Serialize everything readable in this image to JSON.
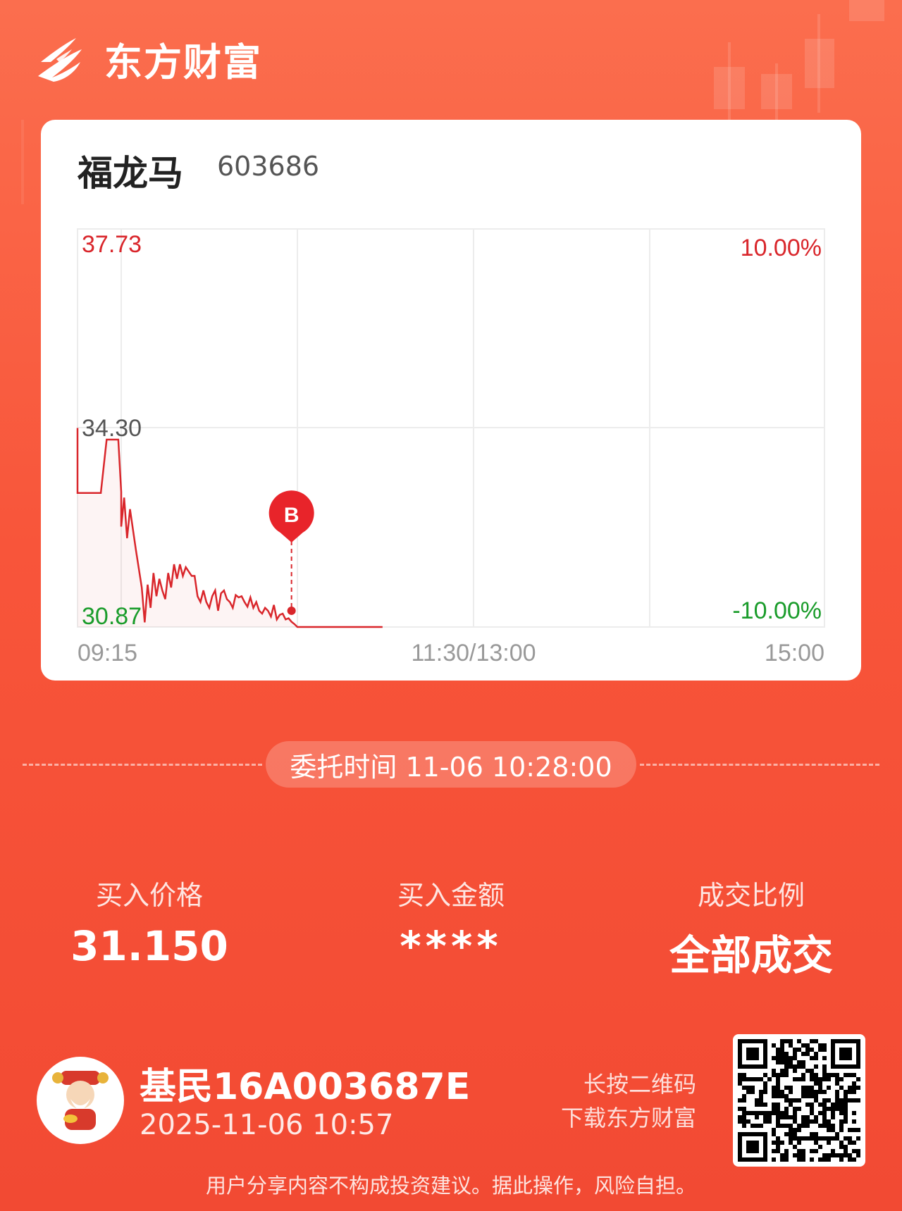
{
  "brand": {
    "name": "东方财富"
  },
  "stock": {
    "name": "福龙马",
    "code": "603686"
  },
  "chart": {
    "price_high_label": "37.73",
    "price_mid_label": "34.30",
    "price_low_label": "30.87",
    "pct_high_label": "10.00%",
    "pct_low_label": "-10.00%",
    "time_start": "09:15",
    "time_mid": "11:30/13:00",
    "time_end": "15:00",
    "marker_label": "B",
    "up_color": "#d9262b",
    "down_color": "#1a9c2b"
  },
  "chart_data": {
    "type": "line",
    "ylim": [
      30.87,
      37.73
    ],
    "points": [
      [
        "09:15",
        34.3
      ],
      [
        "09:15",
        33.18
      ],
      [
        "09:23",
        33.18
      ],
      [
        "09:25",
        34.1
      ],
      [
        "09:29",
        34.1
      ],
      [
        "09:30",
        33.2
      ],
      [
        "09:30",
        32.6
      ],
      [
        "09:31",
        33.1
      ],
      [
        "09:32",
        32.4
      ],
      [
        "09:33",
        32.9
      ],
      [
        "09:35",
        32.2
      ],
      [
        "09:37",
        31.55
      ],
      [
        "09:38",
        30.95
      ],
      [
        "09:39",
        31.6
      ],
      [
        "09:40",
        31.2
      ],
      [
        "09:41",
        31.8
      ],
      [
        "09:42",
        31.4
      ],
      [
        "09:43",
        31.7
      ],
      [
        "09:44",
        31.5
      ],
      [
        "09:45",
        31.35
      ],
      [
        "09:46",
        31.8
      ],
      [
        "09:47",
        31.55
      ],
      [
        "09:48",
        31.95
      ],
      [
        "09:49",
        31.7
      ],
      [
        "09:50",
        31.95
      ],
      [
        "09:51",
        31.75
      ],
      [
        "09:52",
        31.9
      ],
      [
        "09:54",
        31.75
      ],
      [
        "09:55",
        31.75
      ],
      [
        "09:56",
        31.4
      ],
      [
        "09:57",
        31.3
      ],
      [
        "09:58",
        31.5
      ],
      [
        "09:59",
        31.3
      ],
      [
        "10:00",
        31.2
      ],
      [
        "10:01",
        31.4
      ],
      [
        "10:02",
        31.5
      ],
      [
        "10:03",
        31.15
      ],
      [
        "10:04",
        31.45
      ],
      [
        "10:05",
        31.5
      ],
      [
        "10:06",
        31.35
      ],
      [
        "10:07",
        31.3
      ],
      [
        "10:08",
        31.2
      ],
      [
        "10:09",
        31.42
      ],
      [
        "10:10",
        31.38
      ],
      [
        "10:11",
        31.4
      ],
      [
        "10:12",
        31.3
      ],
      [
        "10:13",
        31.22
      ],
      [
        "10:14",
        31.38
      ],
      [
        "10:15",
        31.2
      ],
      [
        "10:16",
        31.3
      ],
      [
        "10:17",
        31.15
      ],
      [
        "10:18",
        31.1
      ],
      [
        "10:19",
        31.2
      ],
      [
        "10:20",
        31.15
      ],
      [
        "10:21",
        31.05
      ],
      [
        "10:22",
        31.25
      ],
      [
        "10:23",
        31.0
      ],
      [
        "10:24",
        31.08
      ],
      [
        "10:25",
        31.1
      ],
      [
        "10:26",
        31.0
      ],
      [
        "10:27",
        31.02
      ],
      [
        "10:28",
        30.96
      ],
      [
        "10:29",
        30.92
      ],
      [
        "10:30",
        30.87
      ],
      [
        "10:59",
        30.87
      ]
    ],
    "buy_marker": {
      "x": "10:28",
      "y": 31.15,
      "label": "B"
    },
    "grid": true
  },
  "commission": {
    "label": "委托时间 11-06 10:28:00"
  },
  "stats": [
    {
      "label": "买入价格",
      "value": "31.150"
    },
    {
      "label": "买入金额",
      "value": "****"
    },
    {
      "label": "成交比例",
      "value": "全部成交"
    }
  ],
  "user": {
    "name": "基民16A003687E",
    "datetime": "2025-11-06 10:57"
  },
  "qr": {
    "hint_line1": "长按二维码",
    "hint_line2": "下载东方财富"
  },
  "disclaimer": "用户分享内容不构成投资建议。据此操作，风险自担。"
}
